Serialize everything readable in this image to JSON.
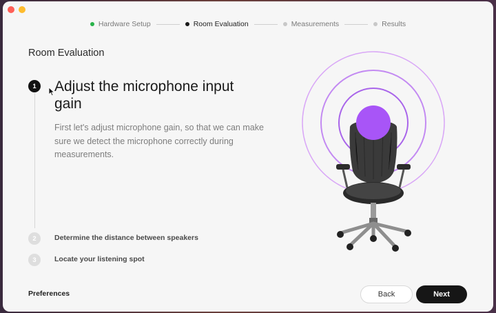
{
  "window": {
    "traffic_lights": [
      "close",
      "minimize"
    ]
  },
  "stepper": {
    "steps": [
      {
        "label": "Hardware Setup",
        "status": "done"
      },
      {
        "label": "Room Evaluation",
        "status": "current"
      },
      {
        "label": "Measurements",
        "status": "pending"
      },
      {
        "label": "Results",
        "status": "pending"
      }
    ]
  },
  "main": {
    "section_title": "Room Evaluation",
    "steps": [
      {
        "number": "1",
        "title": "Adjust the microphone input gain",
        "description": "First let's adjust microphone gain, so that we can make sure we detect the microphone correctly during measurements."
      },
      {
        "number": "2",
        "title": "Determine the distance between speakers"
      },
      {
        "number": "3",
        "title": "Locate your listening spot"
      }
    ]
  },
  "footer": {
    "preferences_label": "Preferences",
    "back_label": "Back",
    "next_label": "Next"
  },
  "colors": {
    "accent_purple": "#a855f7",
    "ring_purple": "#c084fc",
    "done_green": "#29b34a",
    "primary_button": "#161616"
  }
}
